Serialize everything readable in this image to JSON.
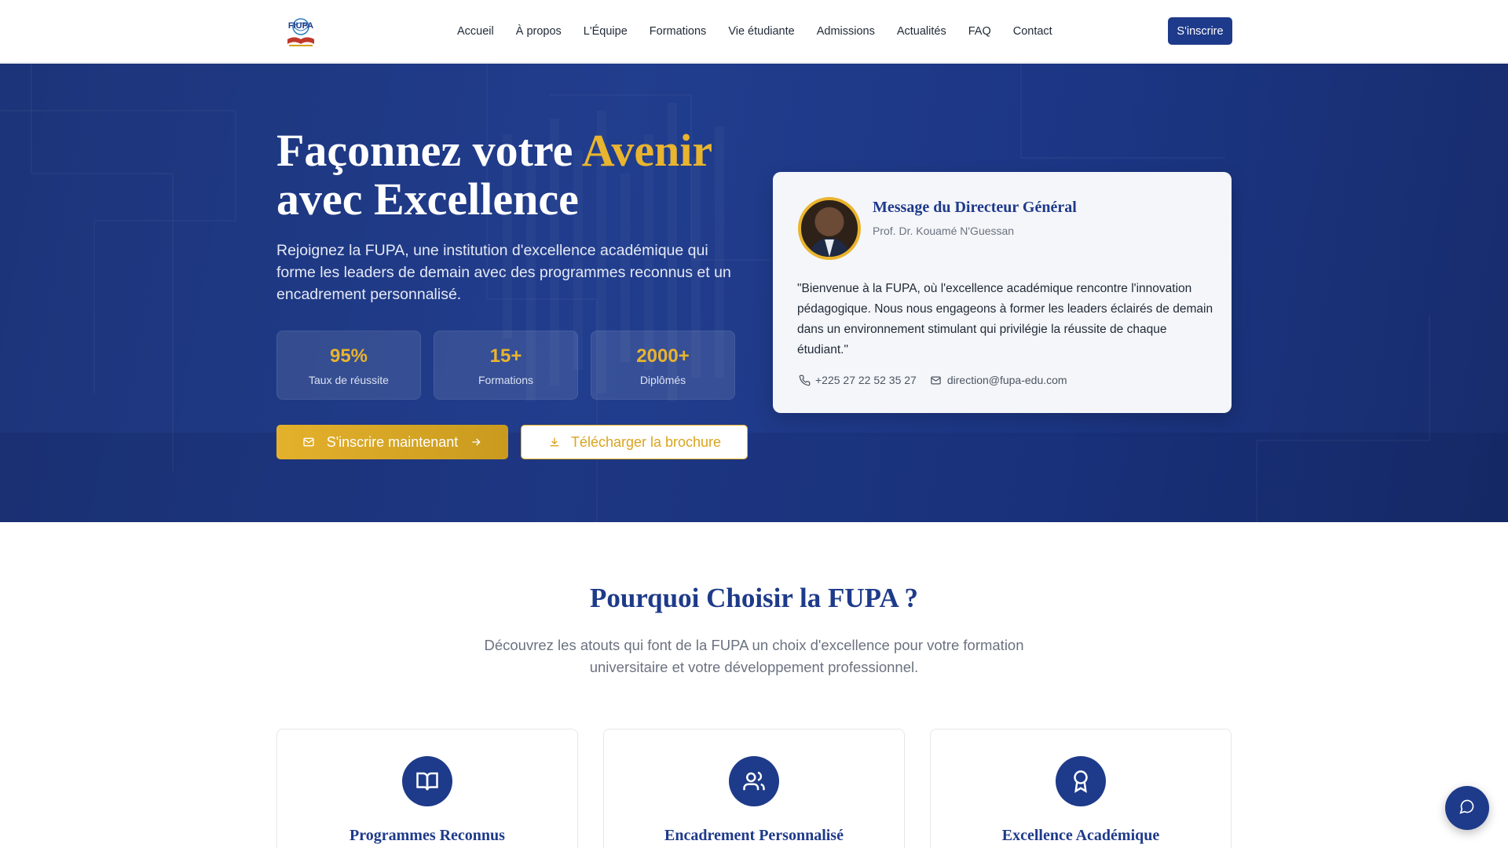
{
  "nav": {
    "logo_text": "FIUPA",
    "links": [
      "Accueil",
      "À propos",
      "L'Équipe",
      "Formations",
      "Vie étudiante",
      "Admissions",
      "Actualités",
      "FAQ",
      "Contact"
    ],
    "cta_label": "S'inscrire"
  },
  "hero": {
    "title_part1": "Façonnez votre ",
    "title_accent": "Avenir",
    "title_part2": "avec Excellence",
    "subtitle": "Rejoignez la FUPA, une institution d'excellence académique qui forme les leaders de demain avec des programmes reconnus et un encadrement personnalisé.",
    "stats": [
      {
        "value": "95%",
        "label": "Taux de réussite"
      },
      {
        "value": "15+",
        "label": "Formations"
      },
      {
        "value": "2000+",
        "label": "Diplômés"
      }
    ],
    "primary_button": "S'inscrire maintenant",
    "secondary_button": "Télécharger la brochure"
  },
  "director_card": {
    "title": "Message du Directeur Général",
    "name": "Prof. Dr. Kouamé N'Guessan",
    "quote": "\"Bienvenue à la FUPA, où l'excellence académique rencontre l'innovation pédagogique. Nous nous engageons à former les leaders éclairés de demain dans un environnement stimulant qui privilégie la réussite de chaque étudiant.\"",
    "phone": "+225 27 22 52 35 27",
    "email": "direction@fupa-edu.com"
  },
  "why_section": {
    "title": "Pourquoi Choisir la FUPA ?",
    "subtitle": "Découvrez les atouts qui font de la FUPA un choix d'excellence pour votre formation universitaire et votre développement professionnel.",
    "features": [
      {
        "title": "Programmes Reconnus",
        "icon": "book-open-icon"
      },
      {
        "title": "Encadrement Personnalisé",
        "icon": "users-icon"
      },
      {
        "title": "Excellence Académique",
        "icon": "award-icon"
      }
    ]
  },
  "colors": {
    "primary": "#1e3a8a",
    "accent": "#e9b42e",
    "hero_bg": "#213d8d"
  }
}
